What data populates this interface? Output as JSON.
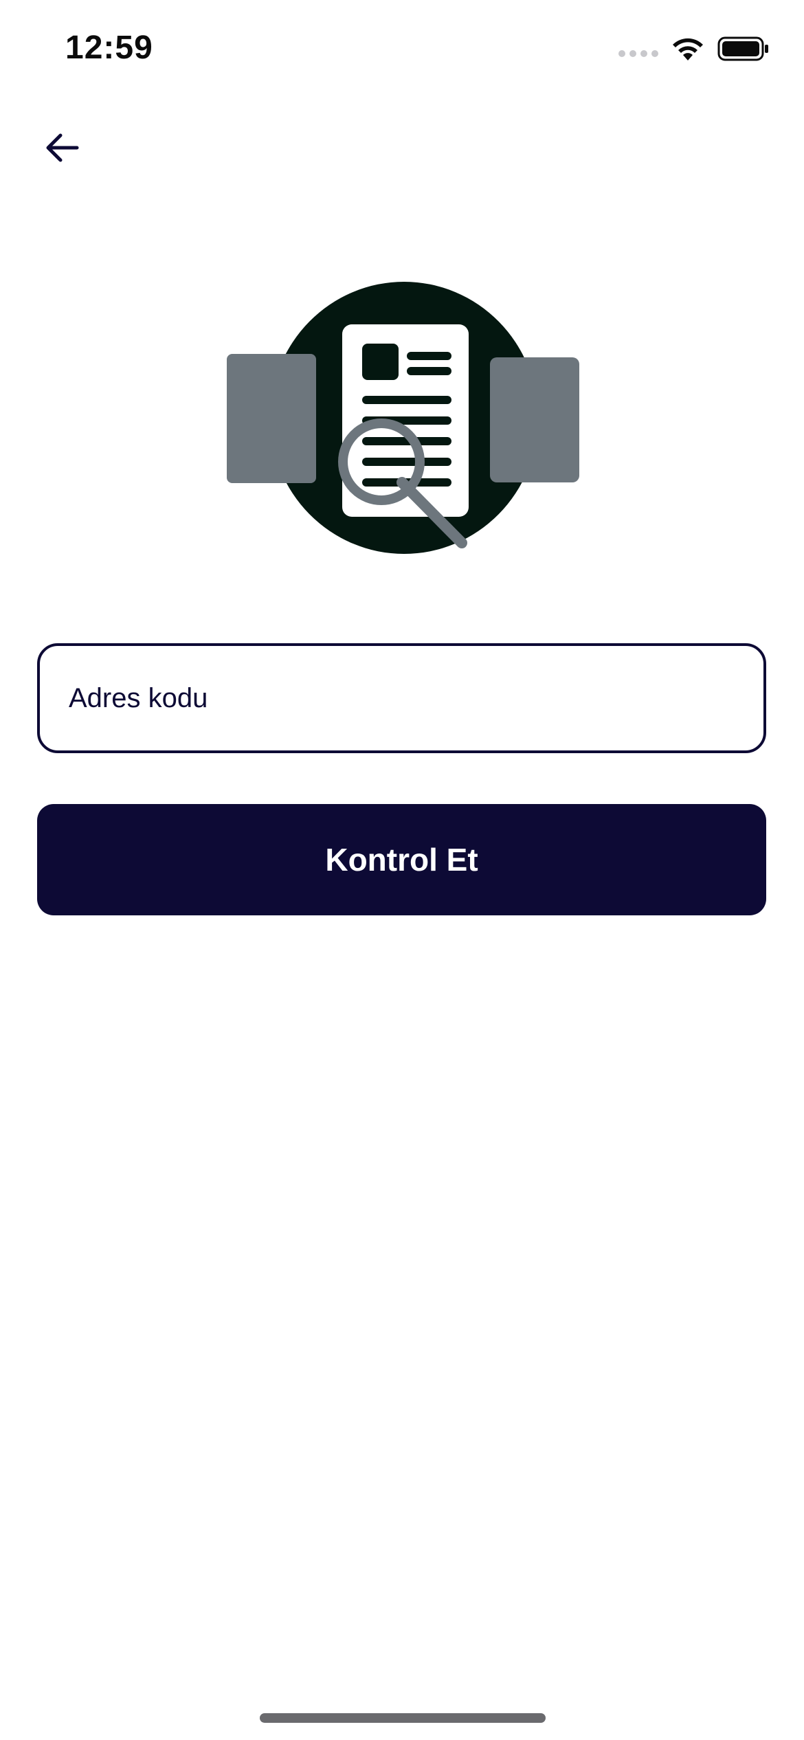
{
  "status_bar": {
    "time": "12:59"
  },
  "icons": {
    "back": "arrow-left-icon",
    "wifi": "wifi-icon",
    "battery": "battery-icon",
    "illustration": "document-search-illustration"
  },
  "form": {
    "address_placeholder": "Adres kodu",
    "address_value": "",
    "submit_label": "Kontrol Et"
  },
  "colors": {
    "primary": "#0d0a35",
    "illustration_dark": "#041710",
    "illustration_gray": "#6d767d",
    "background": "#ffffff"
  }
}
